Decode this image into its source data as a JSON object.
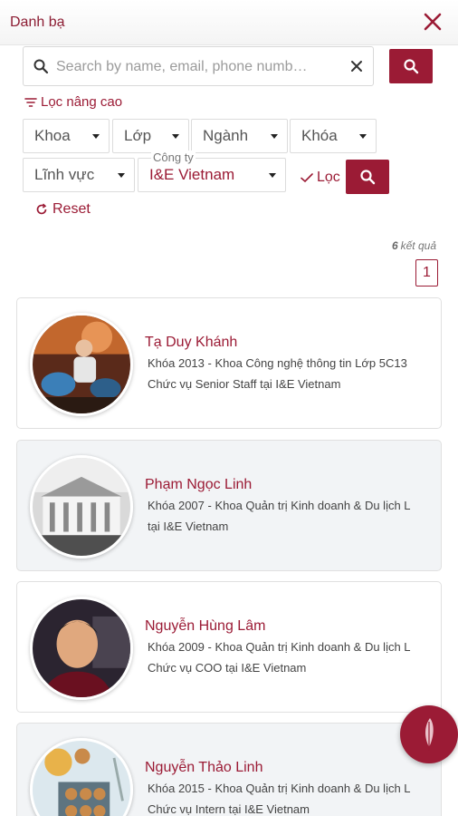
{
  "header": {
    "title": "Danh bạ",
    "close_icon": "close-icon"
  },
  "search": {
    "placeholder": "Search by name, email, phone numb…",
    "value": ""
  },
  "advanced_filter": {
    "label": "Lọc nâng cao"
  },
  "filters": {
    "khoa": "Khoa",
    "lop": "Lớp",
    "nganh": "Ngành",
    "khoa_year": "Khóa",
    "linh_vuc": "Lĩnh vực",
    "cong_ty_label": "Công ty",
    "cong_ty_value": "I&E Vietnam",
    "apply_label": "Lọc",
    "reset_label": "Reset"
  },
  "results": {
    "count": "6",
    "suffix": "kết quả",
    "page": "1"
  },
  "contacts": [
    {
      "name": "Tạ Duy Khánh",
      "line1": "Khóa 2013 - Khoa Công nghệ thông tin Lớp 5C13",
      "line2": "Chức vụ Senior Staff tại I&E Vietnam"
    },
    {
      "name": "Phạm Ngọc Linh",
      "line1": "Khóa 2007 - Khoa Quản trị Kinh doanh & Du lịch L",
      "line2": "tại I&E Vietnam"
    },
    {
      "name": "Nguyễn Hùng Lâm",
      "line1": "Khóa 2009 - Khoa Quản trị Kinh doanh & Du lịch L",
      "line2": "Chức vụ COO tại I&E Vietnam"
    },
    {
      "name": "Nguyễn Thảo Linh",
      "line1": "Khóa 2015 - Khoa Quản trị Kinh doanh & Du lịch L",
      "line2": "Chức vụ Intern tại I&E Vietnam"
    }
  ],
  "colors": {
    "brand": "#9b1b35",
    "card_alt": "#f2f4f6"
  }
}
